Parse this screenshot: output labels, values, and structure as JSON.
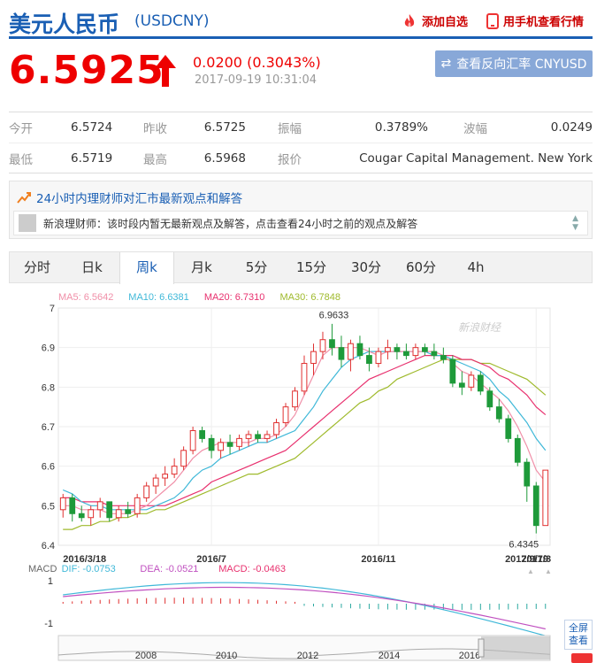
{
  "header": {
    "name": "美元人民币",
    "code": "(USDCNY)",
    "favorite": "添加自选",
    "mobile": "用手机查看行情"
  },
  "price": {
    "value": "6.5925",
    "change": "0.0200 (0.3043%)",
    "time": "2017-09-19 10:31:04",
    "reverse_button": "查看反向汇率 CNYUSD"
  },
  "quote": [
    [
      {
        "label": "今开",
        "value": "6.5724"
      },
      {
        "label": "昨收",
        "value": "6.5725"
      },
      {
        "label": "振幅",
        "value": "0.3789%"
      },
      {
        "label": "波幅",
        "value": "0.0249"
      }
    ],
    [
      {
        "label": "最低",
        "value": "6.5719"
      },
      {
        "label": "最高",
        "value": "6.5968"
      },
      {
        "label": "报价",
        "value": "Cougar Capital Management. New York"
      }
    ]
  ],
  "advisor": {
    "title": "24小时内理财师对汇市最新观点和解答",
    "text": "新浪理财师：该时段内暂无最新观点及解答，点击查看24小时之前的观点及解答"
  },
  "tabs": [
    "分时",
    "日k",
    "周k",
    "月k",
    "5分",
    "15分",
    "30分",
    "60分",
    "4h"
  ],
  "active_tab": "周k",
  "chart": {
    "ma_labels": [
      {
        "text": "MA5: 6.5642",
        "color": "#f08fa8"
      },
      {
        "text": "MA10: 6.6381",
        "color": "#3fb8d8"
      },
      {
        "text": "MA20: 6.7310",
        "color": "#e8306e"
      },
      {
        "text": "MA30: 6.7848",
        "color": "#9fba2c"
      }
    ],
    "y_ticks": [
      "7",
      "6.9",
      "6.8",
      "6.7",
      "6.6",
      "6.5",
      "6.4"
    ],
    "x_ticks": [
      "2016/3/18",
      "2016/7",
      "2016/11",
      "2017/3",
      "2017/9/19"
    ],
    "high_label": "6.9633",
    "low_label": "6.4345",
    "watermark": "新浪财经",
    "macd_labels": [
      {
        "text": "MACD",
        "color": "#666"
      },
      {
        "text": "DIF: -0.0753",
        "color": "#3fb8d8"
      },
      {
        "text": "DEA: -0.0521",
        "color": "#c050c0"
      },
      {
        "text": "MACD: -0.0463",
        "color": "#e8306e"
      }
    ],
    "macd_ticks": [
      "1",
      "-1"
    ],
    "nav_years": [
      "2008",
      "2010",
      "2012",
      "2014",
      "2016"
    ],
    "fullscreen": "全屏查看"
  },
  "chart_data": {
    "type": "candlestick",
    "title": "美元人民币 周k",
    "ylim": [
      6.4,
      7.0
    ],
    "x_start": "2016/3/18",
    "x_end": "2017/9/19",
    "ohlc": [
      [
        6.49,
        6.53,
        6.47,
        6.52
      ],
      [
        6.52,
        6.53,
        6.46,
        6.48
      ],
      [
        6.48,
        6.5,
        6.46,
        6.47
      ],
      [
        6.47,
        6.5,
        6.45,
        6.49
      ],
      [
        6.49,
        6.52,
        6.47,
        6.51
      ],
      [
        6.51,
        6.5,
        6.46,
        6.47
      ],
      [
        6.47,
        6.5,
        6.46,
        6.49
      ],
      [
        6.49,
        6.51,
        6.47,
        6.48
      ],
      [
        6.48,
        6.53,
        6.47,
        6.52
      ],
      [
        6.52,
        6.56,
        6.51,
        6.55
      ],
      [
        6.55,
        6.58,
        6.53,
        6.57
      ],
      [
        6.57,
        6.6,
        6.55,
        6.58
      ],
      [
        6.58,
        6.62,
        6.57,
        6.6
      ],
      [
        6.6,
        6.65,
        6.59,
        6.64
      ],
      [
        6.64,
        6.7,
        6.63,
        6.69
      ],
      [
        6.69,
        6.7,
        6.66,
        6.67
      ],
      [
        6.67,
        6.68,
        6.62,
        6.64
      ],
      [
        6.64,
        6.67,
        6.62,
        6.66
      ],
      [
        6.66,
        6.68,
        6.63,
        6.65
      ],
      [
        6.65,
        6.68,
        6.64,
        6.67
      ],
      [
        6.67,
        6.69,
        6.65,
        6.68
      ],
      [
        6.68,
        6.69,
        6.66,
        6.67
      ],
      [
        6.67,
        6.69,
        6.66,
        6.68
      ],
      [
        6.68,
        6.72,
        6.67,
        6.71
      ],
      [
        6.71,
        6.76,
        6.7,
        6.75
      ],
      [
        6.75,
        6.8,
        6.74,
        6.79
      ],
      [
        6.79,
        6.88,
        6.78,
        6.86
      ],
      [
        6.86,
        6.91,
        6.83,
        6.89
      ],
      [
        6.89,
        6.94,
        6.87,
        6.92
      ],
      [
        6.92,
        6.96,
        6.88,
        6.9
      ],
      [
        6.9,
        6.93,
        6.85,
        6.87
      ],
      [
        6.87,
        6.92,
        6.84,
        6.91
      ],
      [
        6.91,
        6.93,
        6.87,
        6.88
      ],
      [
        6.88,
        6.9,
        6.84,
        6.86
      ],
      [
        6.86,
        6.9,
        6.85,
        6.89
      ],
      [
        6.89,
        6.92,
        6.87,
        6.9
      ],
      [
        6.9,
        6.91,
        6.87,
        6.89
      ],
      [
        6.89,
        6.91,
        6.87,
        6.88
      ],
      [
        6.88,
        6.91,
        6.87,
        6.9
      ],
      [
        6.9,
        6.91,
        6.88,
        6.89
      ],
      [
        6.89,
        6.91,
        6.87,
        6.88
      ],
      [
        6.88,
        6.9,
        6.86,
        6.87
      ],
      [
        6.87,
        6.88,
        6.8,
        6.81
      ],
      [
        6.81,
        6.84,
        6.78,
        6.8
      ],
      [
        6.8,
        6.84,
        6.79,
        6.83
      ],
      [
        6.83,
        6.84,
        6.78,
        6.79
      ],
      [
        6.79,
        6.8,
        6.74,
        6.75
      ],
      [
        6.75,
        6.77,
        6.71,
        6.72
      ],
      [
        6.72,
        6.73,
        6.66,
        6.67
      ],
      [
        6.67,
        6.68,
        6.6,
        6.61
      ],
      [
        6.61,
        6.62,
        6.51,
        6.55
      ],
      [
        6.55,
        6.56,
        6.43,
        6.45
      ],
      [
        6.45,
        6.59,
        6.45,
        6.59
      ]
    ],
    "ma5": [
      6.5,
      6.5,
      6.49,
      6.49,
      6.49,
      6.48,
      6.48,
      6.48,
      6.49,
      6.5,
      6.52,
      6.54,
      6.56,
      6.59,
      6.62,
      6.64,
      6.65,
      6.66,
      6.66,
      6.66,
      6.66,
      6.67,
      6.67,
      6.68,
      6.7,
      6.73,
      6.78,
      6.83,
      6.88,
      6.9,
      6.9,
      6.9,
      6.9,
      6.89,
      6.88,
      6.89,
      6.89,
      6.89,
      6.89,
      6.89,
      6.89,
      6.88,
      6.86,
      6.84,
      6.83,
      6.81,
      6.79,
      6.77,
      6.74,
      6.7,
      6.65,
      6.59,
      6.56
    ],
    "ma10": [
      6.54,
      6.53,
      6.51,
      6.5,
      6.5,
      6.49,
      6.49,
      6.49,
      6.49,
      6.49,
      6.5,
      6.51,
      6.52,
      6.54,
      6.57,
      6.59,
      6.6,
      6.62,
      6.63,
      6.64,
      6.65,
      6.66,
      6.66,
      6.67,
      6.68,
      6.69,
      6.72,
      6.75,
      6.79,
      6.82,
      6.85,
      6.87,
      6.88,
      6.89,
      6.89,
      6.89,
      6.89,
      6.89,
      6.89,
      6.89,
      6.88,
      6.88,
      6.87,
      6.86,
      6.85,
      6.84,
      6.82,
      6.79,
      6.77,
      6.74,
      6.71,
      6.67,
      6.64
    ],
    "ma20": [
      6.52,
      6.52,
      6.51,
      6.51,
      6.51,
      6.5,
      6.5,
      6.5,
      6.5,
      6.5,
      6.5,
      6.5,
      6.51,
      6.52,
      6.53,
      6.54,
      6.56,
      6.57,
      6.58,
      6.59,
      6.6,
      6.61,
      6.62,
      6.63,
      6.64,
      6.66,
      6.68,
      6.7,
      6.72,
      6.74,
      6.76,
      6.78,
      6.8,
      6.82,
      6.83,
      6.84,
      6.85,
      6.86,
      6.87,
      6.88,
      6.88,
      6.88,
      6.88,
      6.87,
      6.87,
      6.86,
      6.85,
      6.83,
      6.82,
      6.8,
      6.78,
      6.75,
      6.73
    ],
    "ma30": [
      6.44,
      6.44,
      6.45,
      6.45,
      6.46,
      6.46,
      6.47,
      6.47,
      6.48,
      6.48,
      6.49,
      6.49,
      6.5,
      6.51,
      6.52,
      6.53,
      6.54,
      6.55,
      6.56,
      6.57,
      6.58,
      6.58,
      6.59,
      6.6,
      6.61,
      6.62,
      6.64,
      6.66,
      6.68,
      6.7,
      6.72,
      6.74,
      6.76,
      6.77,
      6.79,
      6.8,
      6.82,
      6.83,
      6.84,
      6.85,
      6.86,
      6.87,
      6.87,
      6.87,
      6.87,
      6.86,
      6.86,
      6.85,
      6.84,
      6.83,
      6.82,
      6.8,
      6.78
    ]
  }
}
